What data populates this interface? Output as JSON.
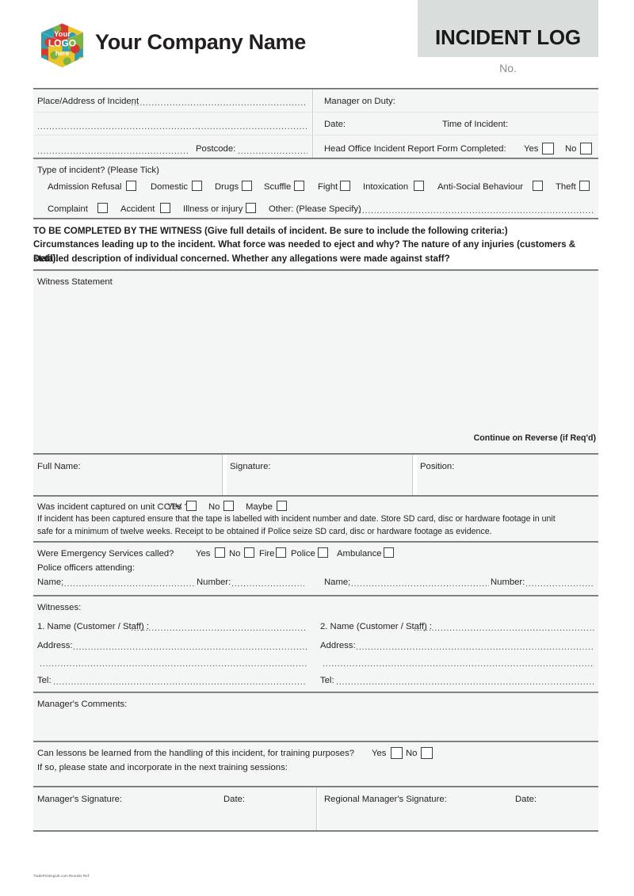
{
  "header": {
    "company_name": "Your Company Name",
    "logo_text_top": "Your",
    "logo_text_mid": "LOGO",
    "logo_text_bottom": "here",
    "document_title": "INCIDENT LOG",
    "number_label": "No.",
    "title_box_color": "#d9dddc"
  },
  "incident_details": {
    "place_label": "Place/Address of Incident",
    "postcode_label": "Postcode:",
    "manager_on_duty_label": "Manager on Duty:",
    "date_label": "Date:",
    "time_label": "Time of Incident:",
    "head_office_label": "Head Office Incident Report Form Completed:",
    "yes_label": "Yes",
    "no_label": "No"
  },
  "incident_type": {
    "heading": "Type of incident? (Please Tick)",
    "row1": [
      "Admission Refusal",
      "Domestic",
      "Drugs",
      "Scuffle",
      "Fight",
      "Intoxication",
      "Anti-Social Behaviour",
      "Theft"
    ],
    "row2": [
      "Complaint",
      "Accident",
      "Illness or injury"
    ],
    "other_label": "Other: (Please Specify)"
  },
  "witness_instructions": {
    "line1": "TO BE COMPLETED BY THE WITNESS (Give full details of incident. Be sure to include the following criteria:)",
    "line2": "Circumstances leading up to the incident. What force was needed to eject and why? The nature of any injuries (customers & staff).",
    "line3": "Detailed description of individual concerned. Whether any allegations were made against staff?"
  },
  "witness_statement": {
    "label": "Witness Statement",
    "continue_note": "Continue on Reverse (if Req'd)"
  },
  "witness_signoff": {
    "full_name_label": "Full Name:",
    "signature_label": "Signature:",
    "position_label": "Position:"
  },
  "cctv": {
    "question": "Was incident captured on unit CCTV ?",
    "yes_label": "Yes",
    "no_label": "No",
    "maybe_label": "Maybe",
    "note_line1": "If incident has been captured ensure that the tape is labelled with incident number and date. Store SD card, disc or hardware footage in unit",
    "note_line2": "safe for a minimum of twelve weeks. Receipt to be obtained if Police seize SD card, disc or hardware footage as evidence."
  },
  "emergency_services": {
    "question": "Were Emergency Services called?",
    "options": [
      "Yes",
      "No",
      "Fire",
      "Police",
      "Ambulance"
    ],
    "police_attending_label": "Police officers attending:",
    "name_label": "Name:",
    "number_label": "Number:"
  },
  "witnesses": {
    "heading": "Witnesses:",
    "name1_label": "1. Name (Customer / Staff) :",
    "name2_label": "2. Name (Customer / Staff) :",
    "address_label": "Address:",
    "tel_label": "Tel:"
  },
  "manager_comments": {
    "label": "Manager's Comments:"
  },
  "lessons": {
    "question": "Can lessons be learned from the handling of this incident, for training purposes?",
    "yes_label": "Yes",
    "no_label": "No",
    "note": "If so, please state and incorporate in the next training sessions:"
  },
  "signoff": {
    "manager_signature_label": "Manager's Signature:",
    "manager_date_label": "Date:",
    "regional_signature_label": "Regional Manager's Signature:",
    "regional_date_label": "Date:"
  },
  "footer": {
    "reorder_ref": "TradePrintingUK.com Reorder Ref:"
  },
  "dots": {
    "d": "......................................................................................................................................................................................................................................................................................."
  }
}
